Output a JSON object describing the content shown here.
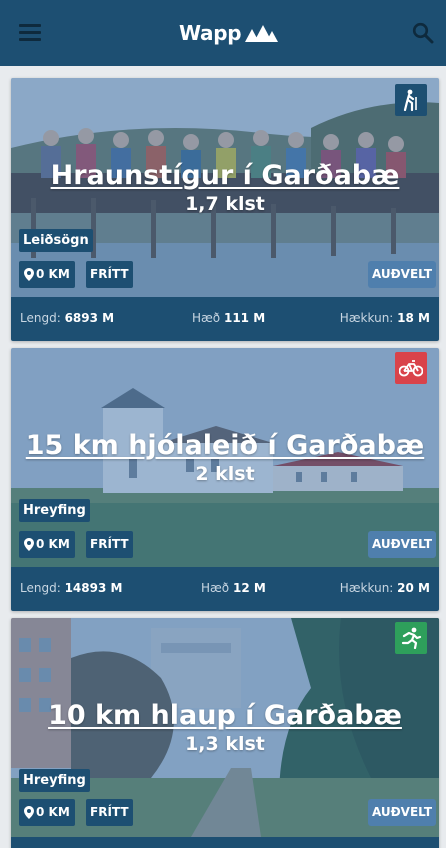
{
  "header": {
    "logo_text": "Wapp",
    "menu_icon": "hamburger-menu-icon",
    "search_icon": "search-icon",
    "background": "#1d4f72"
  },
  "cards": [
    {
      "title": "Hraunstígur í Garðabæ",
      "duration": "1,7 klst",
      "category": "Leiðsögn",
      "distance": "0 KM",
      "price": "FRÍTT",
      "difficulty": "AUÐVELT",
      "activity_icon": "hiking-icon",
      "activity_color": "#1d4f72",
      "stats": {
        "length_label": "Lengd:",
        "length_value": "6893 M",
        "height_label": "Hæð",
        "height_value": "111 M",
        "climb_label": "Hækkun:",
        "climb_value": "18 M"
      }
    },
    {
      "title": "15 km hjólaleið í Garðabæ",
      "duration": "2 klst",
      "category": "Hreyfing",
      "distance": "0 KM",
      "price": "FRÍTT",
      "difficulty": "AUÐVELT",
      "activity_icon": "cycling-icon",
      "activity_color": "#d9434a",
      "stats": {
        "length_label": "Lengd:",
        "length_value": "14893 M",
        "height_label": "Hæð",
        "height_value": "12 M",
        "climb_label": "Hækkun:",
        "climb_value": "20 M"
      }
    },
    {
      "title": "10 km hlaup í Garðabæ",
      "duration": "1,3 klst",
      "category": "Hreyfing",
      "distance": "0 KM",
      "price": "FRÍTT",
      "difficulty": "AUÐVELT",
      "activity_icon": "running-icon",
      "activity_color": "#2e9f5b",
      "stats": {
        "length_label": "",
        "length_value": "",
        "height_label": "",
        "height_value": "",
        "climb_label": "",
        "climb_value": ""
      }
    }
  ]
}
